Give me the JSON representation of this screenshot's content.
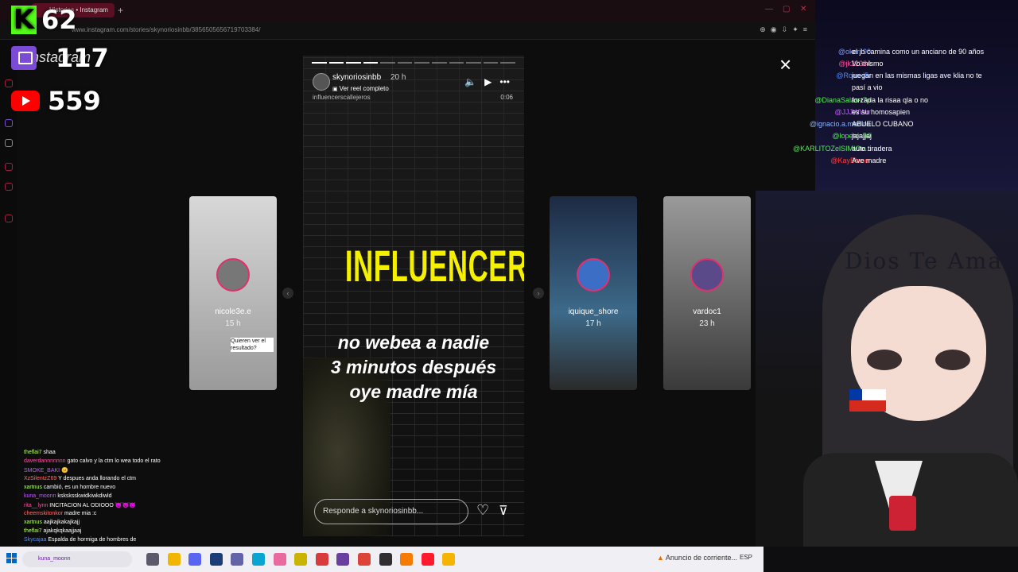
{
  "browser": {
    "tab_title": "Historias • Instagram",
    "url": "www.instagram.com/stories/skynoriosinbb/3856505656719703384/"
  },
  "counters": {
    "kick": {
      "letter": "K",
      "count": "62",
      "color": "#53fc18"
    },
    "twitch": {
      "count": "117",
      "color": "#7b4bd6"
    },
    "youtube": {
      "count": "559",
      "color": "#ff0000"
    },
    "watermark": "Instagram"
  },
  "story": {
    "close_label": "×",
    "username": "skynoriosinbb",
    "time": "20 h",
    "reel_link": "Ver reel completo",
    "subtitle": "influencerscallejeros",
    "clock": "0:06",
    "icons": [
      "volume-icon",
      "play-icon",
      "more-icon"
    ],
    "headline": "INFLUENCERS",
    "caption_lines": [
      "no webea a nadie",
      "3 minutos después",
      "oye madre mía"
    ],
    "reply_placeholder": "Responde a skynoriosinbb...",
    "progress_segments": 12,
    "progress_done": 4,
    "headline_color": "#f5f000"
  },
  "previews": [
    {
      "name": "nicole3e.e",
      "time": "15 h",
      "note": "Quieren ver el resultado?"
    },
    {
      "name": "iquique_shore",
      "time": "17 h",
      "note": ""
    },
    {
      "name": "vardoc1",
      "time": "23 h",
      "note": ""
    }
  ],
  "chat_top": [
    {
      "user": "@oker..90",
      "msg": "el jb camina como un anciano de 90 años",
      "color": "#7c9cff"
    },
    {
      "user": "@jk22334",
      "msg": "Vo mismo",
      "color": "#ff4fa0"
    },
    {
      "user": "@Roan-j5r",
      "msg": "juegan en las mismas ligas ave klia no te",
      "color": "#4f8bff"
    },
    {
      "user": "",
      "msg": "pasí a vio",
      "color": "#ffffff"
    },
    {
      "user": "@DianaSalas-t7p",
      "msg": "forzada la risaa qla o no",
      "color": "#59e85c"
    },
    {
      "user": "@JJJWWrr",
      "msg": "es su homosapien",
      "color": "#c05cff"
    },
    {
      "user": "@ignacio.a.medina",
      "msg": "ABUELO CUBANO",
      "color": "#8ab4ff"
    },
    {
      "user": "@lopeton90",
      "msg": "jajajjaj",
      "color": "#59e85c"
    },
    {
      "user": "@KARLITOZelSIMIOe...",
      "msg": "auto tiradera",
      "color": "#59e85c"
    },
    {
      "user": "@KayBlaner",
      "msg": "Ave madre",
      "color": "#ff3b3b"
    }
  ],
  "chat_bottom_left": [
    {
      "user": "theflai7",
      "msg": "shaa",
      "color": "#b9ff6c"
    },
    {
      "user": "daverdannnnnnn",
      "msg": "gato calvo y la ctm lo wea todo el rato",
      "color": "#ff4fa0"
    },
    {
      "user": "SMOKE_BAKI",
      "msg": "😐",
      "color": "#c05cff"
    },
    {
      "user": "XzSilentzZ69",
      "msg": "Y despues anda llorando el ctm",
      "color": "#ff6b6b"
    },
    {
      "user": "xartnus",
      "msg": "cambió, es un hombre nuevo",
      "color": "#b9ff6c"
    },
    {
      "user": "kuna_moonn",
      "msg": "ksksksskwidkiwkdiwld",
      "color": "#c05cff"
    },
    {
      "user": "rita__lynn",
      "msg": "INCITACION AL ODIOOO 😈😈😈",
      "color": "#ff4fa0"
    },
    {
      "user": "cheemskitonkor",
      "msg": "madre mia :c",
      "color": "#ff6b6b"
    },
    {
      "user": "xartnus",
      "msg": "aajkajkakajkajj",
      "color": "#b9ff6c"
    },
    {
      "user": "theflai7",
      "msg": "ajakqkqkaajjaaj",
      "color": "#b9ff6c"
    },
    {
      "user": "Skycajaa",
      "msg": "Espalda de hormiga de hombres de",
      "color": "#4f8bff"
    }
  ],
  "avatar": {
    "banner_text": "Dios Te Ama"
  },
  "taskbar": {
    "search_text": "kuna_moonn",
    "news_text": "Anuncio de corriente...",
    "lang": "ESP",
    "apps": [
      {
        "name": "task-view-icon",
        "color": "#5a5a6a"
      },
      {
        "name": "file-explorer-icon",
        "color": "#f2b600"
      },
      {
        "name": "discord-icon",
        "color": "#5865f2"
      },
      {
        "name": "vscode-icon",
        "color": "#1d3d7a"
      },
      {
        "name": "teams-icon",
        "color": "#6264a7"
      },
      {
        "name": "edge-icon",
        "color": "#0aa5d1"
      },
      {
        "name": "app-pink-icon",
        "color": "#e86aa0"
      },
      {
        "name": "app-yellow-icon",
        "color": "#c9b400"
      },
      {
        "name": "app-red-icon",
        "color": "#d83b3b"
      },
      {
        "name": "vegas-icon",
        "color": "#6b3fa0"
      },
      {
        "name": "chrome-icon",
        "color": "#db4437"
      },
      {
        "name": "obs-icon",
        "color": "#302e31"
      },
      {
        "name": "app-orange-icon",
        "color": "#f57c00"
      },
      {
        "name": "opera-icon",
        "color": "#ff1b2d"
      },
      {
        "name": "app-chrome-canary-icon",
        "color": "#f4b400"
      }
    ]
  }
}
